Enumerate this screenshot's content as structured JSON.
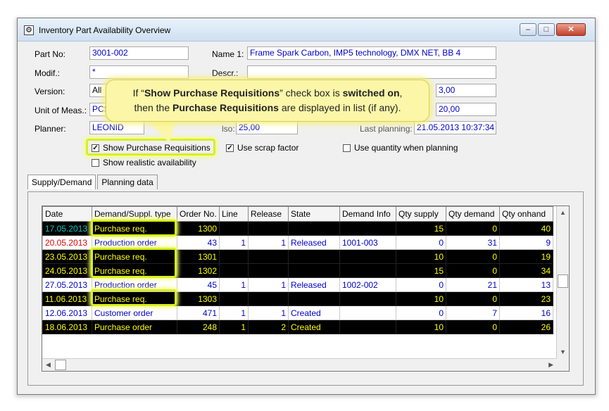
{
  "window": {
    "title": "Inventory Part Availability Overview"
  },
  "form": {
    "part_no_label": "Part No:",
    "part_no": "3001-002",
    "name1_label": "Name 1:",
    "name1": "Frame Spark Carbon, IMP5 technology, DMX NET, BB 4",
    "modif_label": "Modif.:",
    "modif": "*",
    "descr_label": "Descr.:",
    "descr": "",
    "version_label": "Version:",
    "version": "All",
    "uom_label": "Unit of Meas.:",
    "uom": "PCS",
    "planner_label": "Planner:",
    "planner": "LEONID",
    "right1": "3,00",
    "right2": "20,00",
    "obscured_label": "lso:",
    "obscured_value": "25,00",
    "last_planning_label": "Last planning:",
    "last_planning": "21.05.2013 10:37:34"
  },
  "checkboxes": {
    "show_pr": {
      "label": "Show Purchase Requisitions",
      "checked": true
    },
    "scrap": {
      "label": "Use scrap factor",
      "checked": true
    },
    "use_qty": {
      "label": "Use quantity when planning",
      "checked": false
    },
    "realistic": {
      "label": "Show realistic availability",
      "checked": false
    }
  },
  "tabs": [
    "Supply/Demand",
    "Planning data"
  ],
  "callout": {
    "part1": "If “",
    "bold1": "Show Purchase Requisitions",
    "part2": "” check box is ",
    "bold2": "switched on",
    "part3": ",",
    "part4": "then the ",
    "bold3": "Purchase Requisitions",
    "part5": " are displayed in list (if any)."
  },
  "table": {
    "columns": [
      "Date",
      "Demand/Suppl. type",
      "Order No.",
      "Line",
      "Release",
      "State",
      "Demand Info",
      "Qty supply",
      "Qty demand",
      "Qty onhand"
    ],
    "rows": [
      {
        "style": "black",
        "date_color": "#00c8c8",
        "cells": [
          "17.05.2013",
          "Purchase req.",
          "1300",
          "",
          "",
          "",
          "",
          "15",
          "0",
          "40"
        ]
      },
      {
        "style": "white",
        "date_color": "#e00000",
        "cells": [
          "20.05.2013",
          "Production order",
          "43",
          "1",
          "1",
          "Released",
          "1001-003",
          "0",
          "31",
          "9"
        ]
      },
      {
        "style": "black",
        "date_color": "#ffff00",
        "cells": [
          "23.05.2013",
          "Purchase req.",
          "1301",
          "",
          "",
          "",
          "",
          "10",
          "0",
          "19"
        ]
      },
      {
        "style": "black",
        "date_color": "#ffff00",
        "cells": [
          "24.05.2013",
          "Purchase req.",
          "1302",
          "",
          "",
          "",
          "",
          "15",
          "0",
          "34"
        ]
      },
      {
        "style": "white",
        "date_color": "#0000cc",
        "cells": [
          "27.05.2013",
          "Production order",
          "45",
          "1",
          "1",
          "Released",
          "1002-002",
          "0",
          "21",
          "13"
        ]
      },
      {
        "style": "black",
        "date_color": "#ffff00",
        "cells": [
          "11.06.2013",
          "Purchase req.",
          "1303",
          "",
          "",
          "",
          "",
          "10",
          "0",
          "23"
        ]
      },
      {
        "style": "white",
        "date_color": "#0000cc",
        "cells": [
          "12.06.2013",
          "Customer order",
          "471",
          "1",
          "1",
          "Created",
          "",
          "0",
          "7",
          "16"
        ]
      },
      {
        "style": "black",
        "date_color": "#ffff00",
        "cells": [
          "18.06.2013",
          "Purchase order",
          "248",
          "1",
          "2",
          "Created",
          "",
          "10",
          "0",
          "26"
        ]
      }
    ]
  },
  "colors": {
    "black_row_text": "#ffff00",
    "white_row_text": "#0000cc",
    "highlight": "#d8f01a",
    "callout_bg": "#fbf6a8"
  }
}
